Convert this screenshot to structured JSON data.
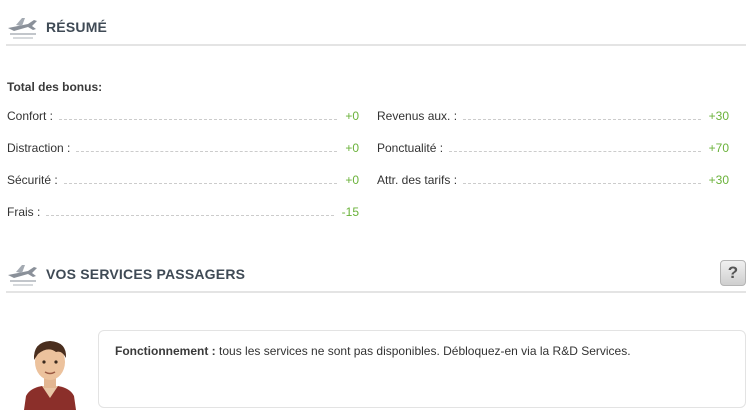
{
  "summary": {
    "title": "RÉSUMÉ",
    "bonus_title": "Total des bonus:",
    "left": [
      {
        "label": "Confort :",
        "value": "+0"
      },
      {
        "label": "Distraction :",
        "value": "+0"
      },
      {
        "label": "Sécurité :",
        "value": "+0"
      },
      {
        "label": "Frais :",
        "value": "-15"
      }
    ],
    "right": [
      {
        "label": "Revenus aux. :",
        "value": "+30"
      },
      {
        "label": "Ponctualité :",
        "value": "+70"
      },
      {
        "label": "Attr. des tarifs :",
        "value": "+30"
      }
    ]
  },
  "services": {
    "title": "VOS SERVICES PASSAGERS",
    "help_label": "?",
    "message_label": "Fonctionnement :",
    "message_text": " tous les services ne sont pas disponibles. Débloquez-en via la R&D Services."
  },
  "colors": {
    "positive": "#6ab23a",
    "header_text": "#3f4a55"
  },
  "icons": {
    "section": "airplane-icon",
    "help": "question-mark-icon",
    "avatar": "advisor-avatar"
  }
}
